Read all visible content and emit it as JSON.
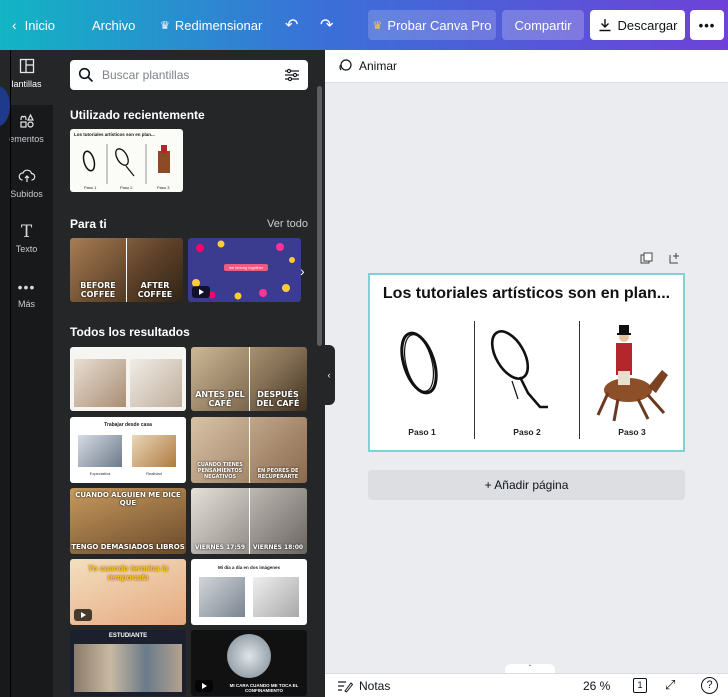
{
  "topbar": {
    "home_label": "Inicio",
    "file_label": "Archivo",
    "resize_label": "Redimensionar",
    "pro_label": "Probar Canva Pro",
    "share_label": "Compartir",
    "download_label": "Descargar",
    "more_label": "•••"
  },
  "rail": {
    "items": [
      {
        "label": "lantillas"
      },
      {
        "label": "ementos"
      },
      {
        "label": "Subidos"
      },
      {
        "label": "Texto"
      },
      {
        "label": "Más"
      }
    ]
  },
  "panel": {
    "search_placeholder": "Buscar plantillas",
    "recent_title": "Utilizado recientemente",
    "recent_thumb": {
      "title": "Los tutoriales artísticos son en plan...",
      "steps": [
        "Paso 1",
        "Paso 2",
        "Paso 3"
      ]
    },
    "for_you_title": "Para ti",
    "see_all": "Ver todo",
    "for_you_thumbs": [
      {
        "caption_left": "BEFORE COFFEE",
        "caption_right": "AFTER COFFEE"
      },
      {
        "caption": "we belong together"
      }
    ],
    "all_results_title": "Todos los resultados",
    "results": [
      {
        "caption": ""
      },
      {
        "caption_left": "ANTES DEL CAFÉ",
        "caption_right": "DESPUÉS DEL CAFÉ"
      },
      {
        "caption": "Trabajar desde casa",
        "sub_left": "Expectativa",
        "sub_right": "Realidad"
      },
      {
        "caption_left": "CUANDO TIENES PENSAMIENTOS NEGATIVOS",
        "caption_right": "EN PEORES DE RECUPERARTE"
      },
      {
        "caption_top": "CUANDO ALGUIEN ME DICE QUE",
        "caption_bottom": "TENGO DEMASIADOS LIBROS"
      },
      {
        "caption_left": "VIERNES 17:59",
        "caption_right": "VIERNES 18:00"
      },
      {
        "caption": "Yo cuando termina la temporada"
      },
      {
        "caption": "Mi día a día en dos imágenes"
      },
      {
        "caption": "ESTUDIANTE"
      },
      {
        "caption": "MI CARA CUANDO ME TOCA EL CONFINAMIENTO"
      }
    ]
  },
  "editor": {
    "animate_label": "Animar",
    "design_title": "Los tutoriales artísticos son en plan...",
    "steps": [
      "Paso 1",
      "Paso 2",
      "Paso 3"
    ],
    "add_page_label": "+ Añadir página"
  },
  "bottom": {
    "notes_label": "Notas",
    "zoom": "26 %",
    "page_count": "1",
    "help_label": "?"
  },
  "colors": {
    "topbar_start": "#12b5c4",
    "topbar_end": "#6e42d8",
    "panel_bg": "#252627",
    "rail_bg": "#18191b",
    "selection": "#7fd1d8"
  }
}
